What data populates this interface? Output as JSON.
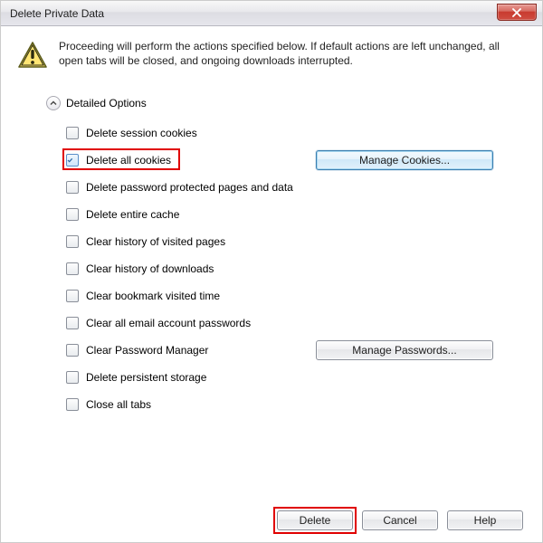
{
  "title": "Delete Private Data",
  "message": "Proceeding will perform the actions specified below. If default actions are left unchanged, all open tabs will be closed, and ongoing downloads interrupted.",
  "section_label": "Detailed Options",
  "options": {
    "session_cookies": "Delete session cookies",
    "all_cookies": "Delete all cookies",
    "pwd_pages": "Delete password protected pages and data",
    "cache": "Delete entire cache",
    "history_pages": "Clear history of visited pages",
    "history_dl": "Clear history of downloads",
    "bookmark_time": "Clear bookmark visited time",
    "email_pwd": "Clear all email account passwords",
    "pwd_mgr": "Clear Password Manager",
    "persistent": "Delete persistent storage",
    "close_tabs": "Close all tabs"
  },
  "buttons": {
    "manage_cookies": "Manage Cookies...",
    "manage_passwords": "Manage Passwords...",
    "delete": "Delete",
    "cancel": "Cancel",
    "help": "Help"
  }
}
